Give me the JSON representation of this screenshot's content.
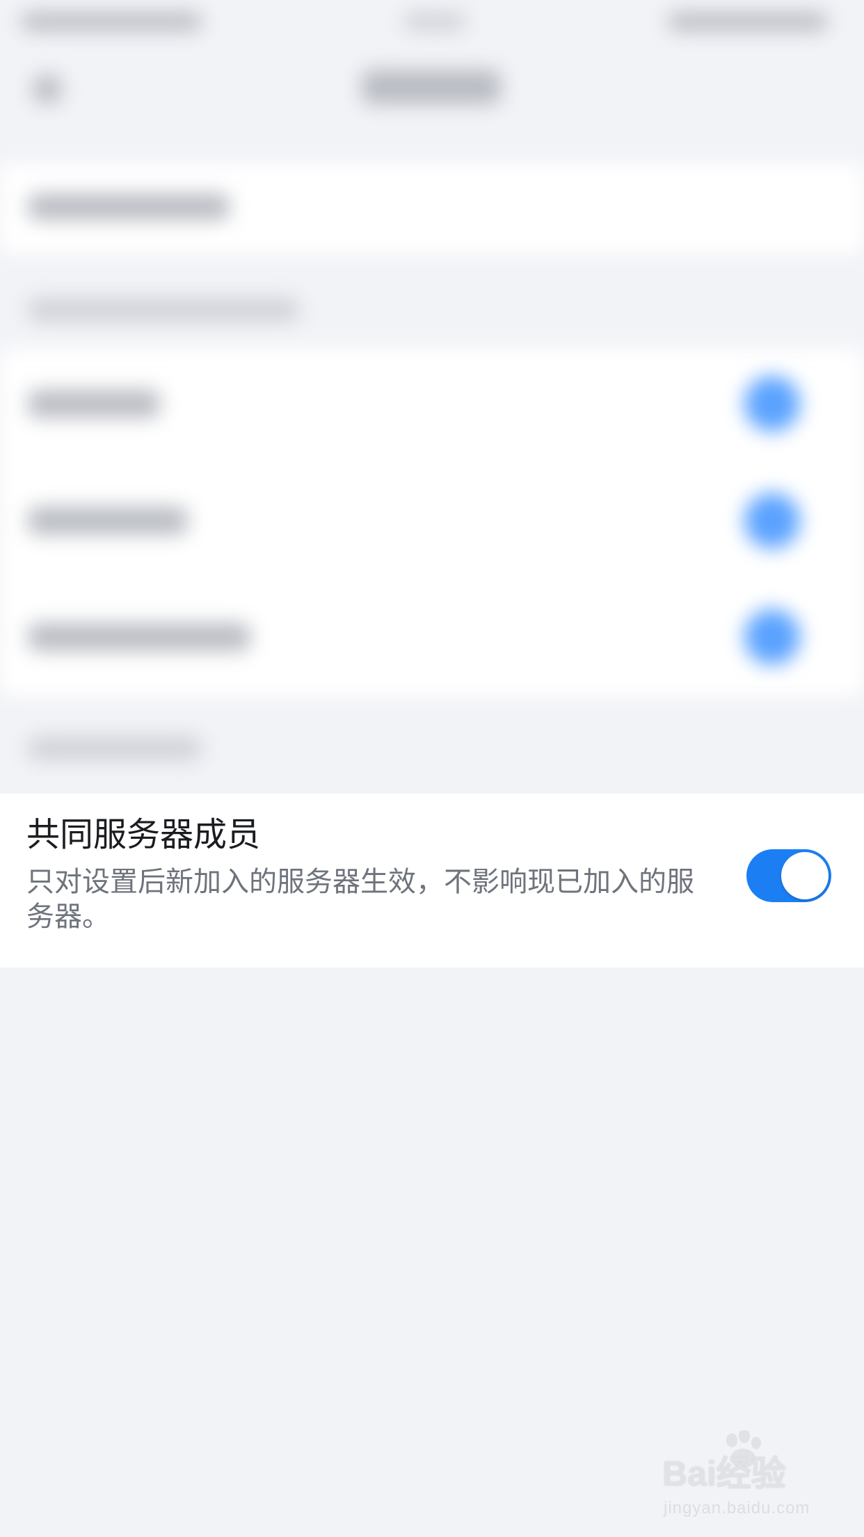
{
  "setting": {
    "title": "共同服务器成员",
    "description": "只对设置后新加入的服务器生效，不影响现已加入的服务器。",
    "toggle_on": true
  },
  "watermark": {
    "logo_text": "Bai经验",
    "sub_text": "jingyan.baidu.com"
  },
  "colors": {
    "background": "#f2f3f7",
    "toggle_on": "#1b7ff3",
    "title_text": "#1b1c1f",
    "description_text": "#6e737c"
  }
}
